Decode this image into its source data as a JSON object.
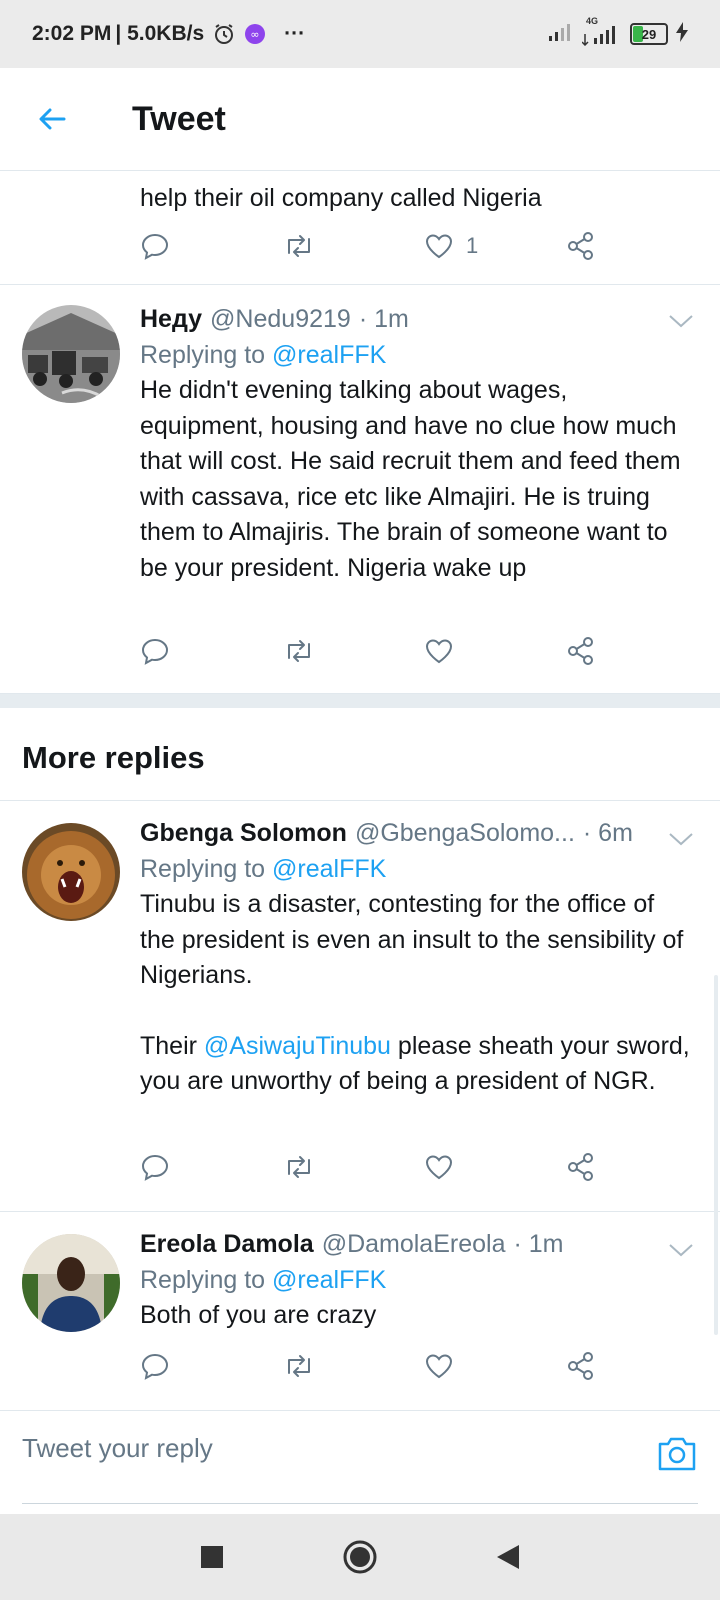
{
  "status_bar": {
    "time": "2:02 PM",
    "speed": "| 5.0KB/s",
    "more": "···",
    "network": "4G",
    "battery": "29",
    "icons": [
      "alarm-icon",
      "app-notification-icon",
      "signal-icon",
      "signal-4g-icon",
      "battery-icon",
      "charging-icon"
    ]
  },
  "app_bar": {
    "title": "Tweet",
    "back_icon": "arrow-left-icon"
  },
  "partial_tweet": {
    "text": "help their oil company called Nigeria",
    "like_count": "1"
  },
  "tweets": [
    {
      "name": "Неду",
      "handle": "@Nedu9219",
      "time": "· 1m",
      "replying_prefix": "Replying to",
      "replying_to": "@realFFK",
      "text": "He didn't evening talking about wages, equipment, housing and have no clue how much that will cost. He said recruit them and feed them with cassava, rice etc like Almajiri. He is truing them to Almajiris. The brain of someone want to be your president. Nigeria wake up"
    }
  ],
  "more_replies": {
    "title": "More replies",
    "tweets": [
      {
        "name": "Gbenga Solomon",
        "handle": "@GbengaSolomo...",
        "time": "· 6m",
        "replying_prefix": "Replying to",
        "replying_to": "@realFFK",
        "text_1": "Tinubu is a disaster, contesting for the office of the president is even an insult to the sensibility of Nigerians.",
        "text_2_prefix": "Their",
        "text_2_mention": "@AsiwajuTinubu",
        "text_2_suffix": "please sheath your sword, you are unworthy of being a president of NGR."
      },
      {
        "name": "Ereola Damola",
        "handle": "@DamolaEreola",
        "time": "· 1m",
        "replying_prefix": "Replying to",
        "replying_to": "@realFFK",
        "text": "Both of you are crazy"
      }
    ]
  },
  "reply_bar": {
    "placeholder": "Tweet your reply",
    "camera_icon": "camera-icon"
  },
  "nav_bar": {
    "icons": [
      "recents-square-icon",
      "home-circle-icon",
      "back-triangle-icon"
    ]
  },
  "colors": {
    "accent": "#1da1f2",
    "secondary_text": "#657786",
    "divider": "#e1e8ed"
  }
}
